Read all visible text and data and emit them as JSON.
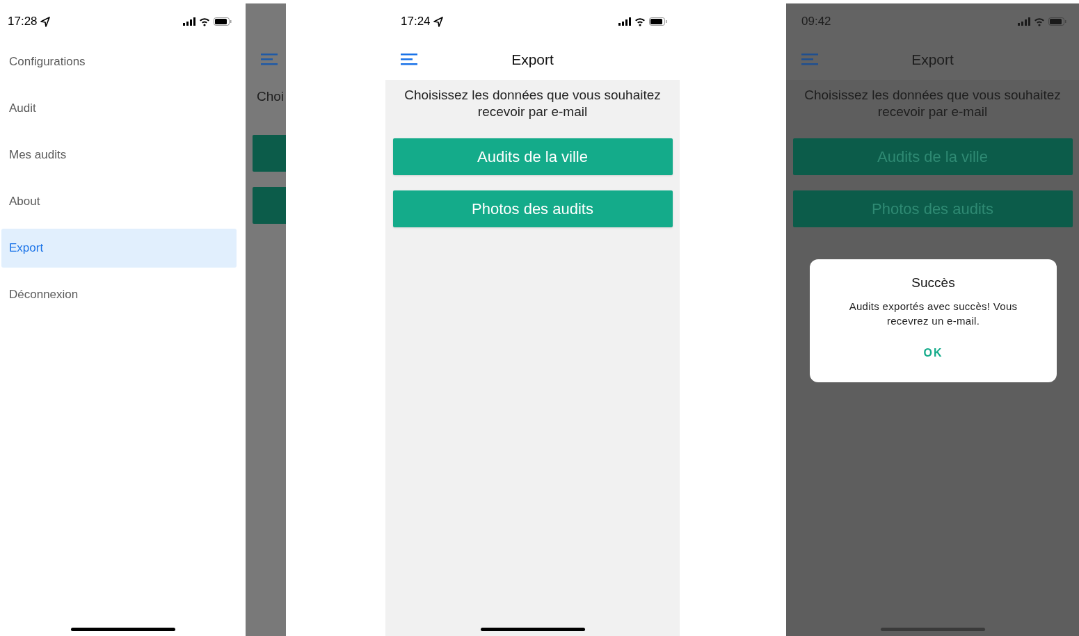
{
  "screens": [
    {
      "kind": "drawer",
      "status_bar": {
        "time": "17:28",
        "location": true
      },
      "menu": [
        {
          "label": "Configurations",
          "selected": false
        },
        {
          "label": "Audit",
          "selected": false
        },
        {
          "label": "Mes audits",
          "selected": false
        },
        {
          "label": "About",
          "selected": false
        },
        {
          "label": "Export",
          "selected": true
        },
        {
          "label": "Déconnexion",
          "selected": false
        }
      ],
      "behind": {
        "prompt": "Choi"
      }
    },
    {
      "kind": "export",
      "dimmed": false,
      "status_bar": {
        "time": "17:24",
        "location": true
      },
      "title": "Export",
      "prompt": "Choisissez les données que vous souhaitez recevoir par e-mail",
      "buttons": [
        "Audits de la ville",
        "Photos des audits"
      ]
    },
    {
      "kind": "export",
      "dimmed": true,
      "status_bar": {
        "time": "09:42",
        "location": false
      },
      "title": "Export",
      "prompt": "Choisissez les données que vous souhaitez recevoir par e-mail",
      "buttons": [
        "Audits de la ville",
        "Photos des audits"
      ],
      "dialog": {
        "title": "Succès",
        "message": "Audits exportés avec succès! Vous recevrez un e-mail.",
        "action": "OK"
      }
    }
  ]
}
